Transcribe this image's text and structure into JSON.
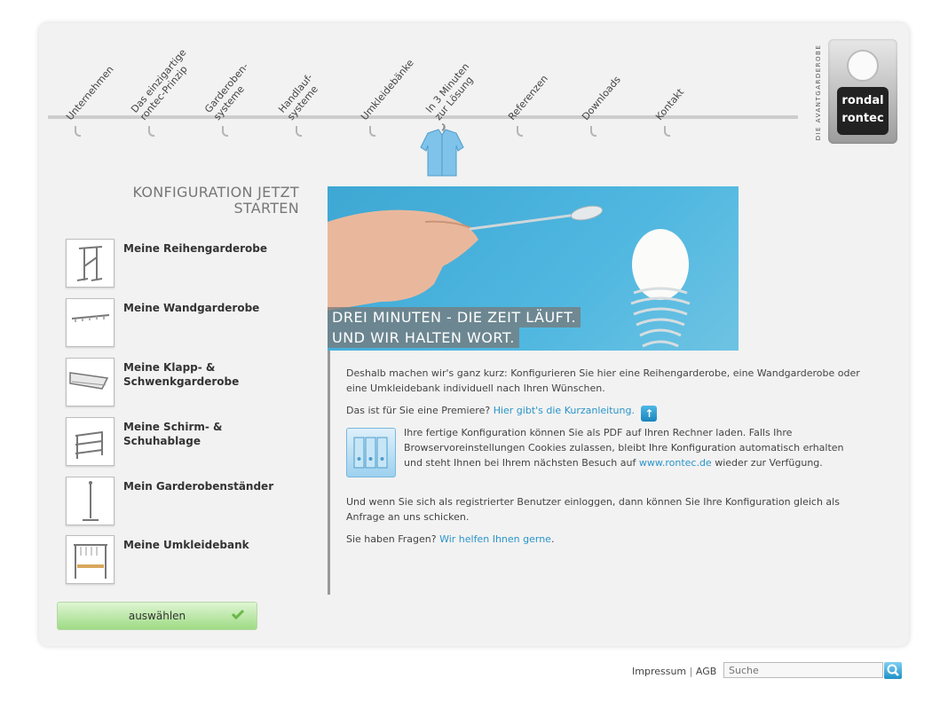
{
  "nav": {
    "items": [
      {
        "label": "Unternehmen"
      },
      {
        "label": "Das einzigartige\nrontec-Prinzip"
      },
      {
        "label": "Garderoben-\nsysteme"
      },
      {
        "label": "Handlauf-\nsysteme"
      },
      {
        "label": "Umkleidebänke"
      },
      {
        "label": "In 3 Minuten\nzur Lösung"
      },
      {
        "label": "Referenzen"
      },
      {
        "label": "Downloads"
      },
      {
        "label": "Kontakt"
      }
    ]
  },
  "brand": {
    "tagline": "DIE AVANTGARDEROBE",
    "logo_line1": "rondal",
    "logo_line2": "rontec"
  },
  "config": {
    "title_line1": "KONFIGURATION JETZT",
    "title_line2": "STARTEN",
    "items": [
      {
        "label": "Meine Reihengarderobe"
      },
      {
        "label": "Meine Wandgarderobe"
      },
      {
        "label": "Meine Klapp- & Schwenkgarderobe"
      },
      {
        "label": "Meine Schirm- & Schuhablage"
      },
      {
        "label": "Mein Garderobenständer"
      },
      {
        "label": "Meine Umkleidebank"
      }
    ],
    "select_label": "auswählen"
  },
  "hero": {
    "line1": "DREI MINUTEN - DIE ZEIT LÄUFT.",
    "line2": "UND WIR HALTEN WORT."
  },
  "content": {
    "p1": "Deshalb machen wir's ganz kurz: Konfigurieren Sie hier eine Reihengarderobe, eine Wandgarderobe oder eine Umkleidebank individuell nach Ihren Wünschen.",
    "p2_text": "Das ist für Sie eine Premiere?",
    "p2_link": "Hier gibt's die Kurzanleitung.",
    "p3_text": "Ihre fertige Konfiguration können Sie als PDF auf Ihren Rechner laden. Falls Ihre Browservoreinstellungen Cookies zulassen, bleibt Ihre Konfiguration automatisch erhalten und steht Ihnen bei Ihrem nächsten Besuch auf",
    "p3_link": "www.rontec.de",
    "p3_end": "wieder zur Verfügung.",
    "p4": "Und wenn Sie sich als registrierter Benutzer einloggen, dann können Sie Ihre Konfiguration gleich als Anfrage an uns schicken.",
    "p5_text": "Sie haben Fragen?",
    "p5_link": "Wir helfen Ihnen gerne",
    "p5_end": "."
  },
  "footer": {
    "impressum": "Impressum",
    "separator": "|",
    "agb": "AGB",
    "search_placeholder": "Suche"
  }
}
